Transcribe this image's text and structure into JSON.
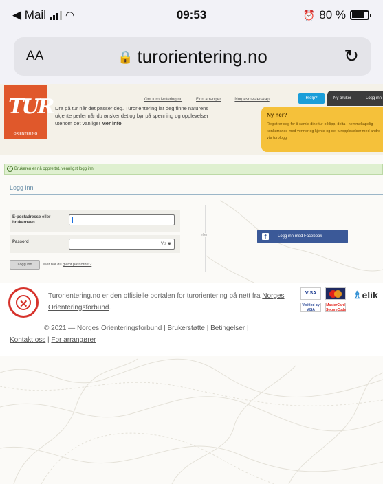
{
  "status_bar": {
    "back_app": "◀ Mail",
    "time": "09:53",
    "battery": "80 %",
    "battery_level": 0.8
  },
  "browser": {
    "text_size_label": "AA",
    "url": "turorientering.no"
  },
  "site": {
    "logo_mark": "TUR",
    "logo_sub": "ORIENTERING",
    "nav": [
      "Om turorientering.no",
      "Finn arrangør",
      "Norgesmesterskap"
    ],
    "help_button": "Hjelp?",
    "new_user_button": "Ny bruker",
    "login_nav_button": "Logg inn",
    "intro_text": "Dra på tur når det passer deg. Turorientering lar deg finne naturens ukjente perler når du ønsker det og byr på spenning og opplevelser utenom det vanlige!",
    "intro_more": "Mer info",
    "promo_title": "Ny her?",
    "promo_body": "Registrer deg for å samle dine tur-o klipp, delta i nemmekapelig konkurranse med venner og kjente og del turopplevelser med andre i vår turblogg.",
    "alert": "Brukeren er nå opprettet, vennligst logg inn.",
    "login_title": "Logg inn",
    "email_label": "E-postadresse eller brukernavn",
    "password_label": "Passord",
    "show_password": "Vis",
    "login_button": "Logg inn",
    "forgot_prefix": "eller har du",
    "forgot_link": "glemt passordet?",
    "or_label": "eller",
    "facebook_button": "Logg inn med Facebook",
    "footer_text": "Turorientering.no er den offisielle portalen for turorientering på nett fra",
    "footer_org": "Norges Orienteringsforbund",
    "copyright": "© 2021 — Norges Orienteringsforbund |",
    "link_support": "Brukerstøtte",
    "link_terms": "Betingelser",
    "link_contact": "Kontakt oss",
    "link_organizers": "For arrangører",
    "card_visa": "VISA",
    "card_verified": "Verified by VISA",
    "card_securecode": "MasterCard SecureCode",
    "payment_provider": "elik"
  }
}
